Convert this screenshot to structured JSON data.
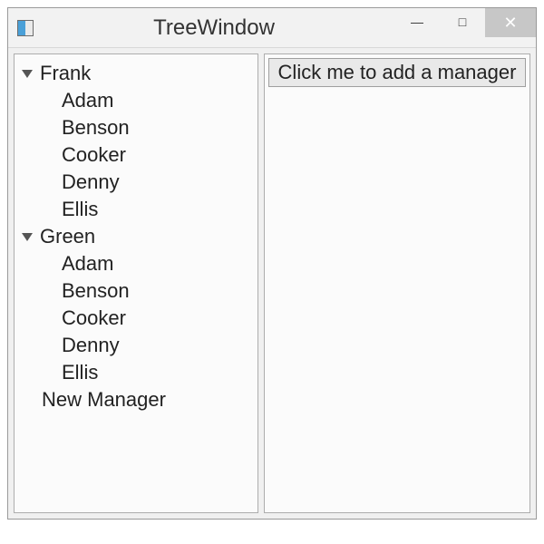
{
  "window": {
    "title": "TreeWindow",
    "buttons": {
      "minimize": "—",
      "maximize": "□",
      "close": "✕"
    }
  },
  "tree": {
    "roots": [
      {
        "label": "Frank",
        "expanded": true,
        "children": [
          "Adam",
          "Benson",
          "Cooker",
          "Denny",
          "Ellis"
        ]
      },
      {
        "label": "Green",
        "expanded": true,
        "children": [
          "Adam",
          "Benson",
          "Cooker",
          "Denny",
          "Ellis"
        ]
      },
      {
        "label": "New Manager",
        "expanded": false,
        "children": []
      }
    ]
  },
  "actions": {
    "add_manager_label": "Click me to add a manager"
  }
}
